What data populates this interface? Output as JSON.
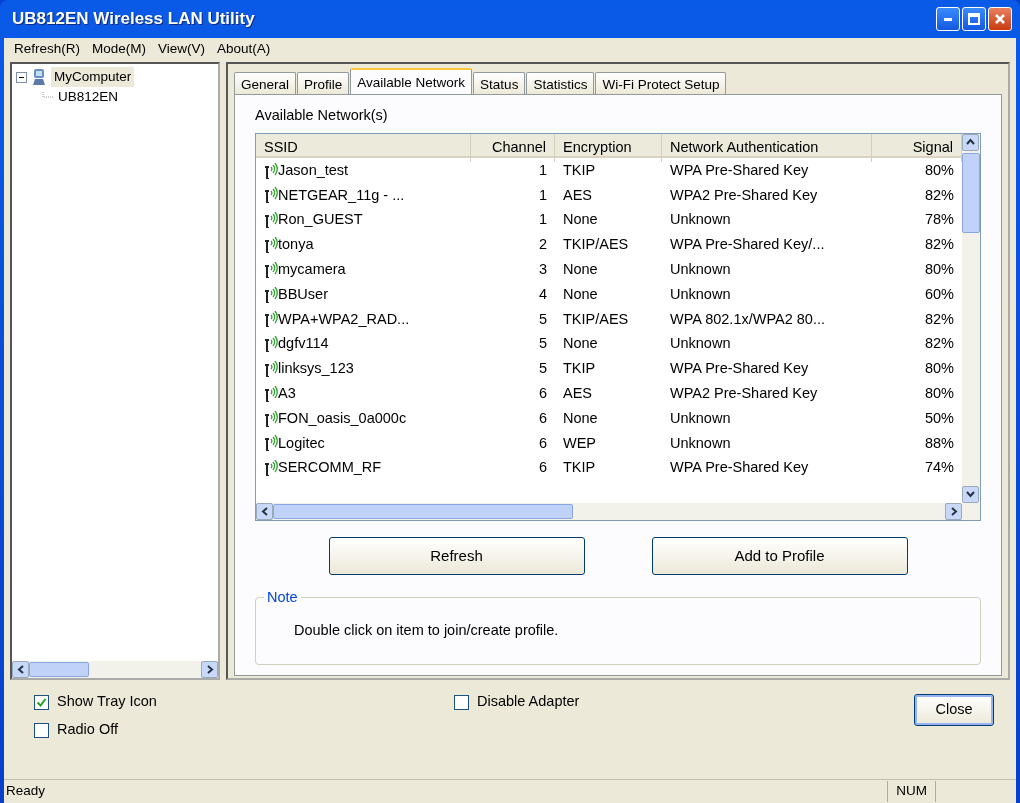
{
  "window": {
    "title": "UB812EN Wireless LAN Utility"
  },
  "menu": [
    "Refresh(R)",
    "Mode(M)",
    "View(V)",
    "About(A)"
  ],
  "tree": [
    {
      "label": "MyComputer",
      "selected": true,
      "expanded": true,
      "children": [
        {
          "label": "UB812EN"
        }
      ]
    }
  ],
  "tabs": [
    {
      "label": "General",
      "selected": false
    },
    {
      "label": "Profile",
      "selected": false
    },
    {
      "label": "Available Network",
      "selected": true
    },
    {
      "label": "Status",
      "selected": false
    },
    {
      "label": "Statistics",
      "selected": false
    },
    {
      "label": "Wi-Fi Protect Setup",
      "selected": false
    }
  ],
  "section_label": "Available Network(s)",
  "table": {
    "columns": [
      "SSID",
      "Channel",
      "Encryption",
      "Network Authentication",
      "Signal"
    ],
    "rows": [
      [
        "Jason_test",
        "1",
        "TKIP",
        "WPA Pre-Shared Key",
        "80%"
      ],
      [
        "NETGEAR_11g - ...",
        "1",
        "AES",
        "WPA2 Pre-Shared Key",
        "82%"
      ],
      [
        "Ron_GUEST",
        "1",
        "None",
        "Unknown",
        "78%"
      ],
      [
        "tonya",
        "2",
        "TKIP/AES",
        "WPA Pre-Shared Key/...",
        "82%"
      ],
      [
        "mycamera",
        "3",
        "None",
        "Unknown",
        "80%"
      ],
      [
        "BBUser",
        "4",
        "None",
        "Unknown",
        "60%"
      ],
      [
        "WPA+WPA2_RAD...",
        "5",
        "TKIP/AES",
        "WPA 802.1x/WPA2 80...",
        "82%"
      ],
      [
        "dgfv114",
        "5",
        "None",
        "Unknown",
        "82%"
      ],
      [
        "linksys_123",
        "5",
        "TKIP",
        "WPA Pre-Shared Key",
        "80%"
      ],
      [
        "A3",
        "6",
        "AES",
        "WPA2 Pre-Shared Key",
        "80%"
      ],
      [
        "FON_oasis_0a000c",
        "6",
        "None",
        "Unknown",
        "50%"
      ],
      [
        "Logitec",
        "6",
        "WEP",
        "Unknown",
        "88%"
      ],
      [
        "SERCOMM_RF",
        "6",
        "TKIP",
        "WPA Pre-Shared Key",
        "74%"
      ]
    ]
  },
  "buttons": [
    "Refresh",
    "Add to Profile"
  ],
  "note": {
    "title": "Note",
    "text": "Double click on item to join/create profile."
  },
  "left_options": [
    {
      "label": "Show Tray Icon",
      "checked": true
    },
    {
      "label": "Radio Off",
      "checked": false
    }
  ],
  "middle_options": [
    {
      "label": "Disable Adapter",
      "checked": false
    }
  ],
  "close_button": "Close",
  "status_bar": {
    "text": "Ready",
    "indicator": "NUM"
  }
}
